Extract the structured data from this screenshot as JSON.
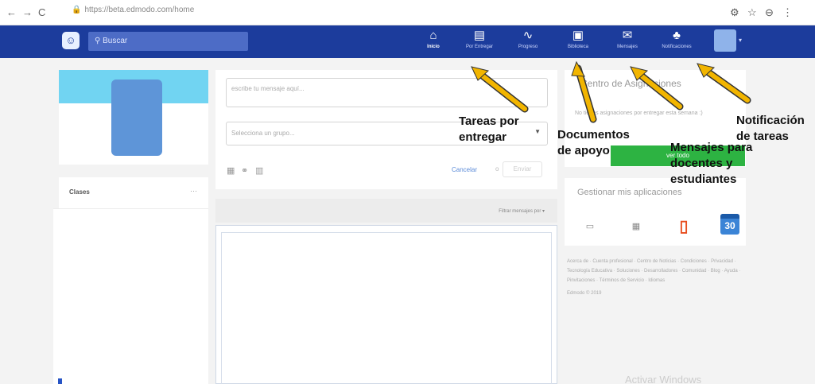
{
  "browser": {
    "url": "https://beta.edmodo.com/home",
    "nav_icons": [
      "←",
      "→",
      "C"
    ],
    "right_icons": [
      "⚙",
      "☆",
      "⊖",
      "⋮"
    ]
  },
  "topnav": {
    "logo": "☺",
    "search_placeholder": "Buscar",
    "items": [
      {
        "label": "Inicio",
        "icon": "⌂"
      },
      {
        "label": "Por Entregar",
        "icon": "▤"
      },
      {
        "label": "Progreso",
        "icon": "∿"
      },
      {
        "label": "Biblioteca",
        "icon": "▣"
      },
      {
        "label": "Mensajes",
        "icon": "✉"
      },
      {
        "label": "Notificaciones",
        "icon": "♣"
      }
    ],
    "brand_color": "#1c3c9c"
  },
  "left": {
    "classes_label": "Clases",
    "classes_more": "···"
  },
  "composer": {
    "message_placeholder": "escribe tu mensaje aquí...",
    "group_placeholder": "Selecciona un grupo...",
    "cancel": "Cancelar",
    "or": "o",
    "send": "Enviar"
  },
  "feed": {
    "filter_label": "Filtrar mensajes por ▾"
  },
  "right": {
    "app_center_title": "Centro de Asignaciones",
    "app_center_text": "No tienes asignaciones por entregar esta semana :)",
    "see_all": "ver todo",
    "manage_title": "Gestionar mis aplicaciones",
    "calendar_day": "30",
    "footer_links": "Acerca de · Cuenta profesional · Centro de Noticias · Condiciones · Privacidad · Tecnología Educativa · Soluciones · Desarrolladores · Comunidad · Blog · Ayuda · Pinvitaciones · Términos de Servicio · Idiomas",
    "footer_copyright": "Edmodo © 2019",
    "watermark": "Activar Windows"
  },
  "annotations": {
    "tareas": "Tareas por entregar",
    "documentos": "Documentos de apoyo",
    "mensajes": "Mensajes para docentes y estudiantes",
    "notificacion": "Notificación de tareas",
    "arrow_color": "#f2b500"
  }
}
